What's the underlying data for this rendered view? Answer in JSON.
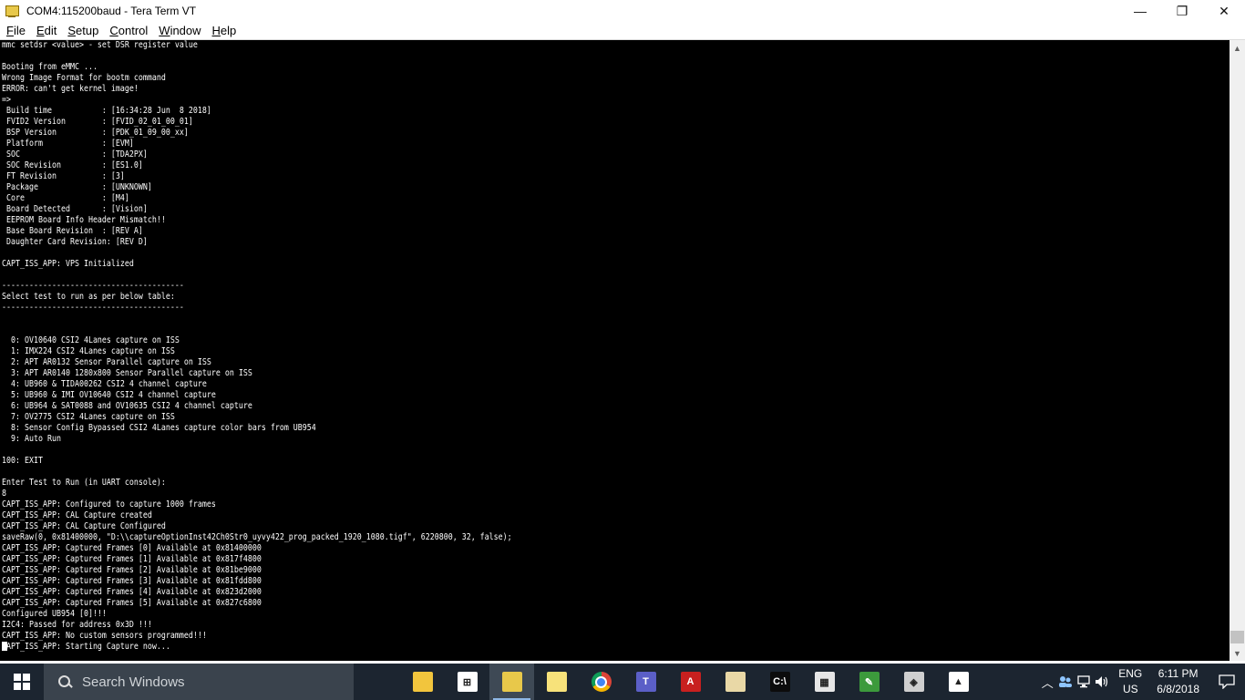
{
  "window": {
    "title": "COM4:115200baud - Tera Term VT",
    "minimize": "—",
    "maximize": "❐",
    "close": "✕"
  },
  "menu": [
    {
      "label": "File",
      "accel": "F",
      "rest": "ile"
    },
    {
      "label": "Edit",
      "accel": "E",
      "rest": "dit"
    },
    {
      "label": "Setup",
      "accel": "S",
      "rest": "etup"
    },
    {
      "label": "Control",
      "accel": "C",
      "rest": "ontrol"
    },
    {
      "label": "Window",
      "accel": "W",
      "rest": "indow"
    },
    {
      "label": "Help",
      "accel": "H",
      "rest": "elp"
    }
  ],
  "terminal": {
    "lines": [
      "mmc setdsr <value> - set DSR register value",
      "",
      "Booting from eMMC ...",
      "Wrong Image Format for bootm command",
      "ERROR: can't get kernel image!",
      "=>",
      " Build time           : [16:34:28 Jun  8 2018]",
      " FVID2 Version        : [FVID_02_01_00_01]",
      " BSP Version          : [PDK_01_09_00_xx]",
      " Platform             : [EVM]",
      " SOC                  : [TDA2PX]",
      " SOC Revision         : [ES1.0]",
      " FT Revision          : [3]",
      " Package              : [UNKNOWN]",
      " Core                 : [M4]",
      " Board Detected       : [Vision]",
      " EEPROM Board Info Header Mismatch!!",
      " Base Board Revision  : [REV A]",
      " Daughter Card Revision: [REV D]",
      "",
      "CAPT_ISS_APP: VPS Initialized",
      "",
      "----------------------------------------",
      "Select test to run as per below table:",
      "----------------------------------------",
      "",
      "",
      "  0: OV10640 CSI2 4Lanes capture on ISS",
      "  1: IMX224 CSI2 4Lanes capture on ISS",
      "  2: APT AR0132 Sensor Parallel capture on ISS",
      "  3: APT AR0140 1280x800 Sensor Parallel capture on ISS",
      "  4: UB960 & TIDA00262 CSI2 4 channel capture",
      "  5: UB960 & IMI OV10640 CSI2 4 channel capture",
      "  6: UB964 & SAT0088 and OV10635 CSI2 4 channel capture",
      "  7: OV2775 CSI2 4Lanes capture on ISS",
      "  8: Sensor Config Bypassed CSI2 4Lanes capture color bars from UB954",
      "  9: Auto Run",
      "",
      "100: EXIT",
      "",
      "Enter Test to Run (in UART console):",
      "8",
      "CAPT_ISS_APP: Configured to capture 1000 frames",
      "CAPT_ISS_APP: CAL Capture created",
      "CAPT_ISS_APP: CAL Capture Configured",
      "saveRaw(0, 0x81400000, \"D:\\\\captureOptionInst42Ch0Str0_uyvy422_prog_packed_1920_1080.tigf\", 6220800, 32, false);",
      "CAPT_ISS_APP: Captured Frames [0] Available at 0x81400000",
      "CAPT_ISS_APP: Captured Frames [1] Available at 0x817f4800",
      "CAPT_ISS_APP: Captured Frames [2] Available at 0x81be9000",
      "CAPT_ISS_APP: Captured Frames [3] Available at 0x81fdd800",
      "CAPT_ISS_APP: Captured Frames [4] Available at 0x823d2000",
      "CAPT_ISS_APP: Captured Frames [5] Available at 0x827c6800",
      "Configured UB954 [0]!!!",
      "I2C4: Passed for address 0x3D !!!",
      "CAPT_ISS_APP: No custom sensors programmed!!!",
      "CAPT_ISS_APP: Starting Capture now..."
    ]
  },
  "taskbar": {
    "search_placeholder": "Search Windows",
    "apps": [
      {
        "name": "task-view-icon",
        "glyph": "⧉",
        "bg": "transparent",
        "running": false,
        "active": false
      },
      {
        "name": "file-explorer-icon",
        "glyph": "",
        "bg": "#f2c53d",
        "running": false,
        "active": false
      },
      {
        "name": "store-icon",
        "glyph": "⊞",
        "bg": "#ffffff",
        "running": false,
        "active": false
      },
      {
        "name": "tera-term-icon",
        "glyph": "",
        "bg": "#e8c84a",
        "running": true,
        "active": true
      },
      {
        "name": "sticky-notes-icon",
        "glyph": "",
        "bg": "#f7e27a",
        "running": false,
        "active": false
      },
      {
        "name": "chrome-icon",
        "glyph": "",
        "bg": "#db4437",
        "running": false,
        "active": false
      },
      {
        "name": "teams-icon",
        "glyph": "T",
        "bg": "#5b5fc7",
        "running": false,
        "active": false
      },
      {
        "name": "acrobat-icon",
        "glyph": "A",
        "bg": "#c8201f",
        "running": false,
        "active": false
      },
      {
        "name": "paint-icon",
        "glyph": "",
        "bg": "#e9d8a6",
        "running": false,
        "active": false
      },
      {
        "name": "command-prompt-icon",
        "glyph": "C:\\",
        "bg": "#0c0c0c",
        "running": false,
        "active": false
      },
      {
        "name": "calculator-icon",
        "glyph": "▦",
        "bg": "#e6e6e6",
        "running": false,
        "active": false
      },
      {
        "name": "editor-icon",
        "glyph": "✎",
        "bg": "#3c9a3c",
        "running": false,
        "active": false
      },
      {
        "name": "cube-app-icon",
        "glyph": "◈",
        "bg": "#cfcfcf",
        "running": false,
        "active": false
      },
      {
        "name": "photos-icon",
        "glyph": "▲",
        "bg": "#ffffff",
        "running": false,
        "active": false
      }
    ],
    "tray": {
      "language_top": "ENG",
      "language_bottom": "US",
      "time": "6:11 PM",
      "date": "6/8/2018"
    }
  }
}
